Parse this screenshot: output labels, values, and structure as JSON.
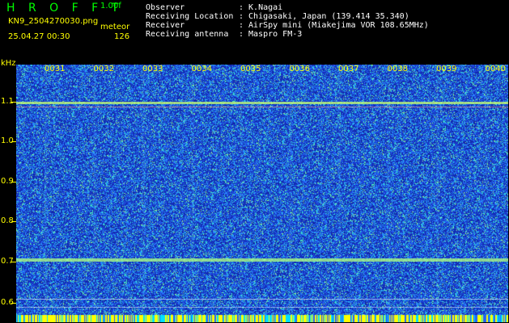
{
  "header": {
    "logo": "H R O F F T",
    "version": "1.00f",
    "filename": "KN9_2504270030.png",
    "mode": "meteor",
    "datetime": "25.04.27 00:30",
    "count": "126"
  },
  "station": [
    {
      "key": "Observer",
      "value": ": K.Nagai"
    },
    {
      "key": "Receiving Location",
      "value": ": Chigasaki, Japan (139.414 35.340)"
    },
    {
      "key": "Receiver",
      "value": ": AirSpy mini (Miakejima VOR 108.65MHz)"
    },
    {
      "key": "Receiving antenna",
      "value": ": Maspro FM-3"
    }
  ],
  "axis": {
    "y_unit": "kHz",
    "y_ticks": [
      "1.1",
      "1.0",
      "0.9",
      "0.8",
      "0.7",
      "0.6"
    ],
    "x_ticks": [
      "0031",
      "0032",
      "0033",
      "0034",
      "0035",
      "0036",
      "0037",
      "0038",
      "0039",
      "0040"
    ]
  },
  "colors": {
    "background": "#000000",
    "spectrum_base": "#1a3cc8",
    "label_yellow": "#ffff00",
    "logo_green": "#00ff00"
  }
}
